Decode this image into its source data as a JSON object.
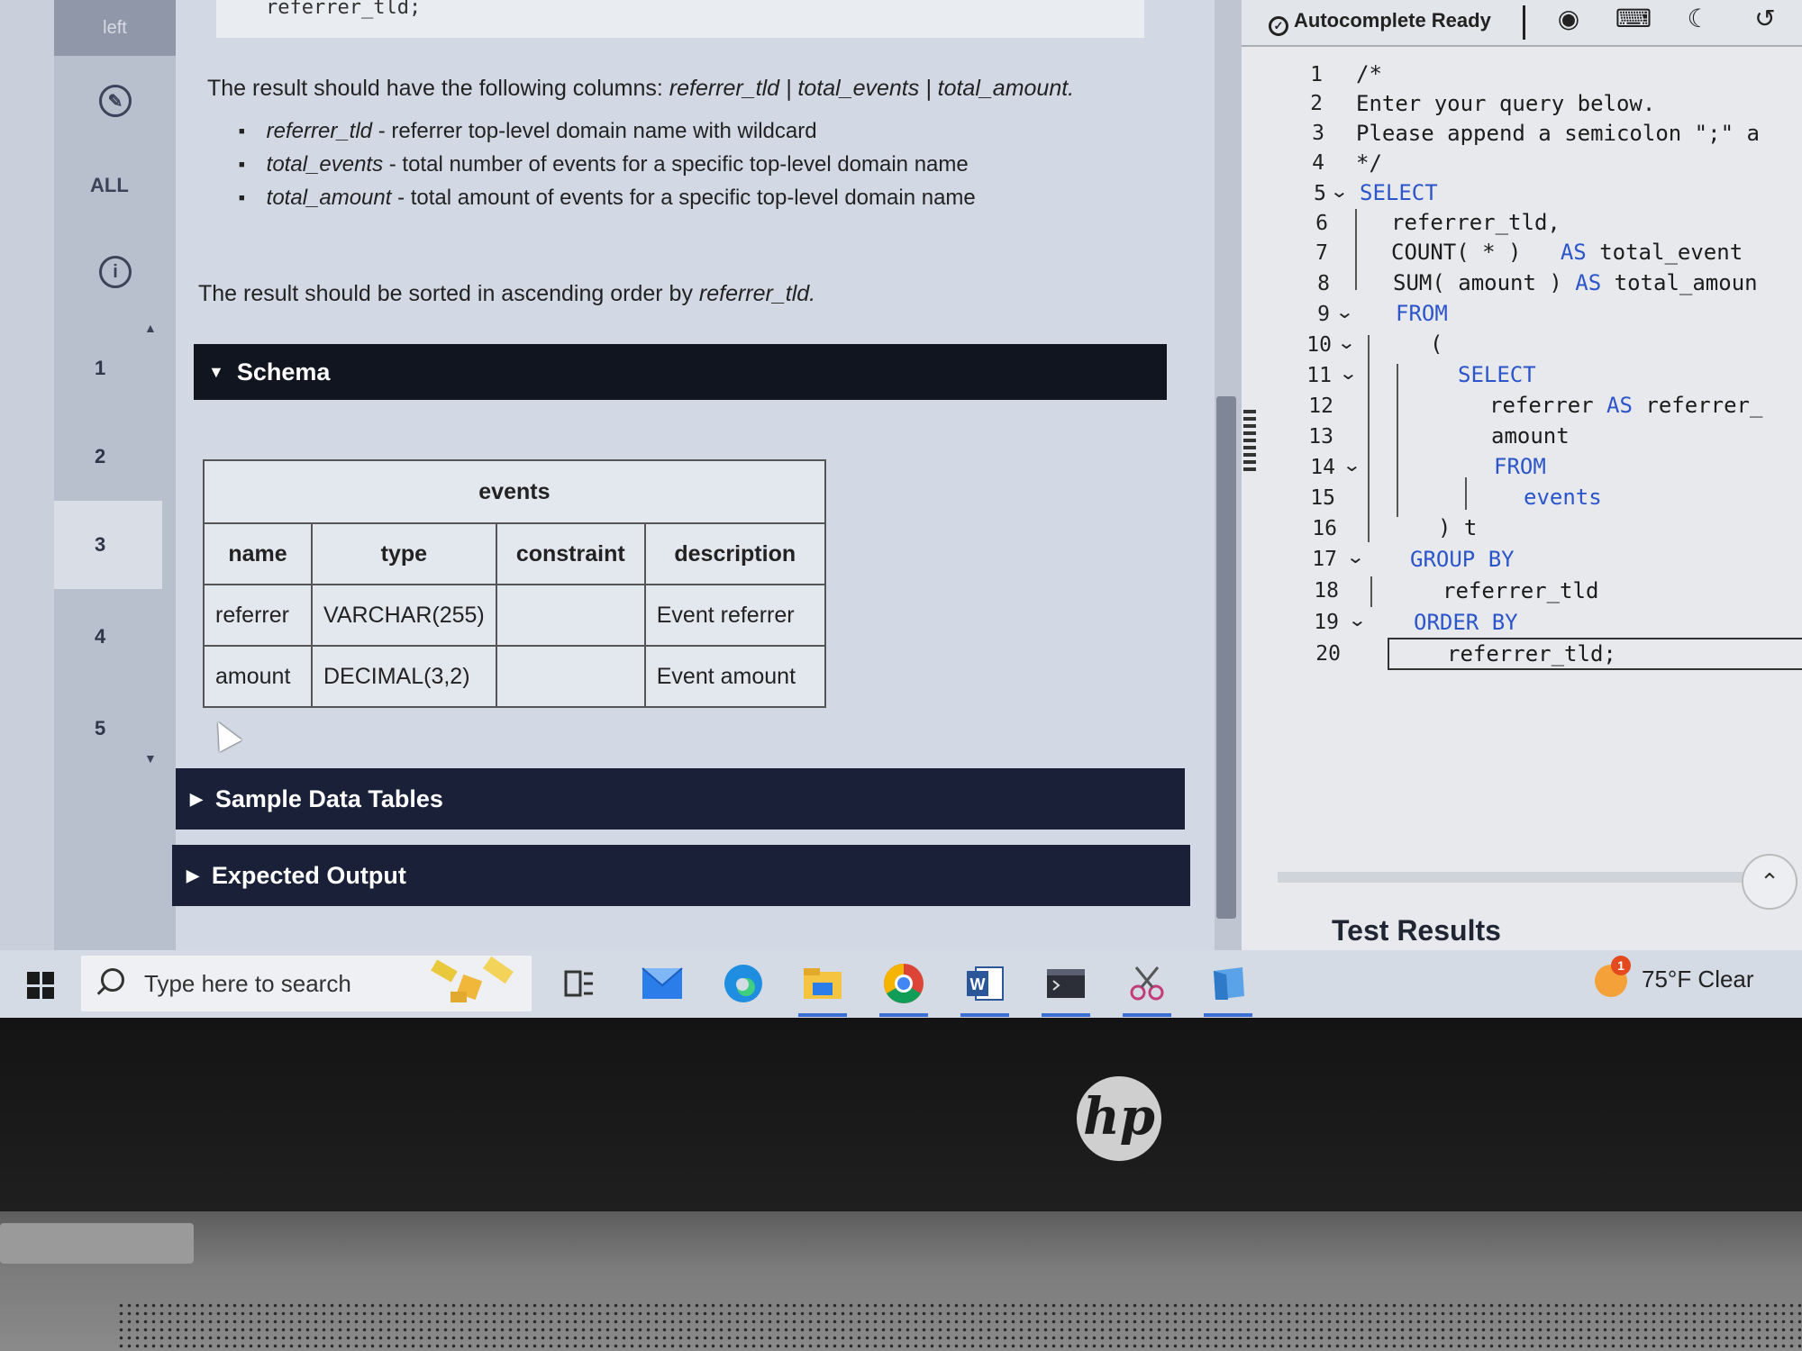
{
  "leftnav": {
    "top_tab": "left",
    "all_label": "ALL",
    "questions": [
      "1",
      "2",
      "3",
      "4",
      "5"
    ],
    "active_question": "3"
  },
  "problem": {
    "code_snippet": "referrer_tld;",
    "columns_intro": "The result should have the following columns: ",
    "columns_list": "referrer_tld | total_events | total_amount.",
    "bullets": [
      {
        "name": "referrer_tld",
        "desc": " - referrer top-level domain name with wildcard"
      },
      {
        "name": "total_events",
        "desc": " - total number of events for a specific top-level domain name"
      },
      {
        "name": "total_amount",
        "desc": " - total amount of events for a specific top-level domain name"
      }
    ],
    "sort_intro": "The result should be sorted in ascending order by ",
    "sort_col": "referrer_tld.",
    "schema_label": "Schema",
    "schema": {
      "table_name": "events",
      "headers": [
        "name",
        "type",
        "constraint",
        "description"
      ],
      "rows": [
        [
          "referrer",
          "VARCHAR(255)",
          "",
          "Event referrer"
        ],
        [
          "amount",
          "DECIMAL(3,2)",
          "",
          "Event amount"
        ]
      ]
    },
    "sample_label": "Sample Data Tables",
    "expected_label": "Expected Output"
  },
  "editor": {
    "autocomplete": "Autocomplete Ready",
    "line_numbers": [
      "1",
      "2",
      "3",
      "4",
      "5",
      "6",
      "7",
      "8",
      "9",
      "10",
      "11",
      "12",
      "13",
      "14",
      "15",
      "16",
      "17",
      "18",
      "19",
      "20"
    ],
    "lines": {
      "l1": "/*",
      "l2": "Enter your query below.",
      "l3": "Please append a semicolon \";\" a",
      "l4": "*/",
      "l5_kw": "SELECT",
      "l6": "referrer_tld,",
      "l7_a": "COUNT( * )   ",
      "l7_kw": "AS",
      "l7_b": " total_event",
      "l8_a": "SUM( amount ) ",
      "l8_kw": "AS",
      "l8_b": " total_amoun",
      "l9_kw": "FROM",
      "l10": "(",
      "l11_kw": "SELECT",
      "l12_a": "referrer ",
      "l12_kw": "AS",
      "l12_b": " referrer_",
      "l13": "amount",
      "l14_kw": "FROM",
      "l15": "events",
      "l16": ") t",
      "l17_kw": "GROUP BY",
      "l18": "referrer_tld",
      "l19_kw": "ORDER BY",
      "l20": "referrer_tld;"
    },
    "test_results": "Test Results"
  },
  "taskbar": {
    "search_placeholder": "Type here to search",
    "weather": "75°F  Clear",
    "weather_badge": "1"
  },
  "laptop": {
    "brand": "hp"
  },
  "colors": {
    "keyword": "#2b55c9",
    "section_bar": "#1a2037",
    "taskbar": "#d5dbe5"
  }
}
